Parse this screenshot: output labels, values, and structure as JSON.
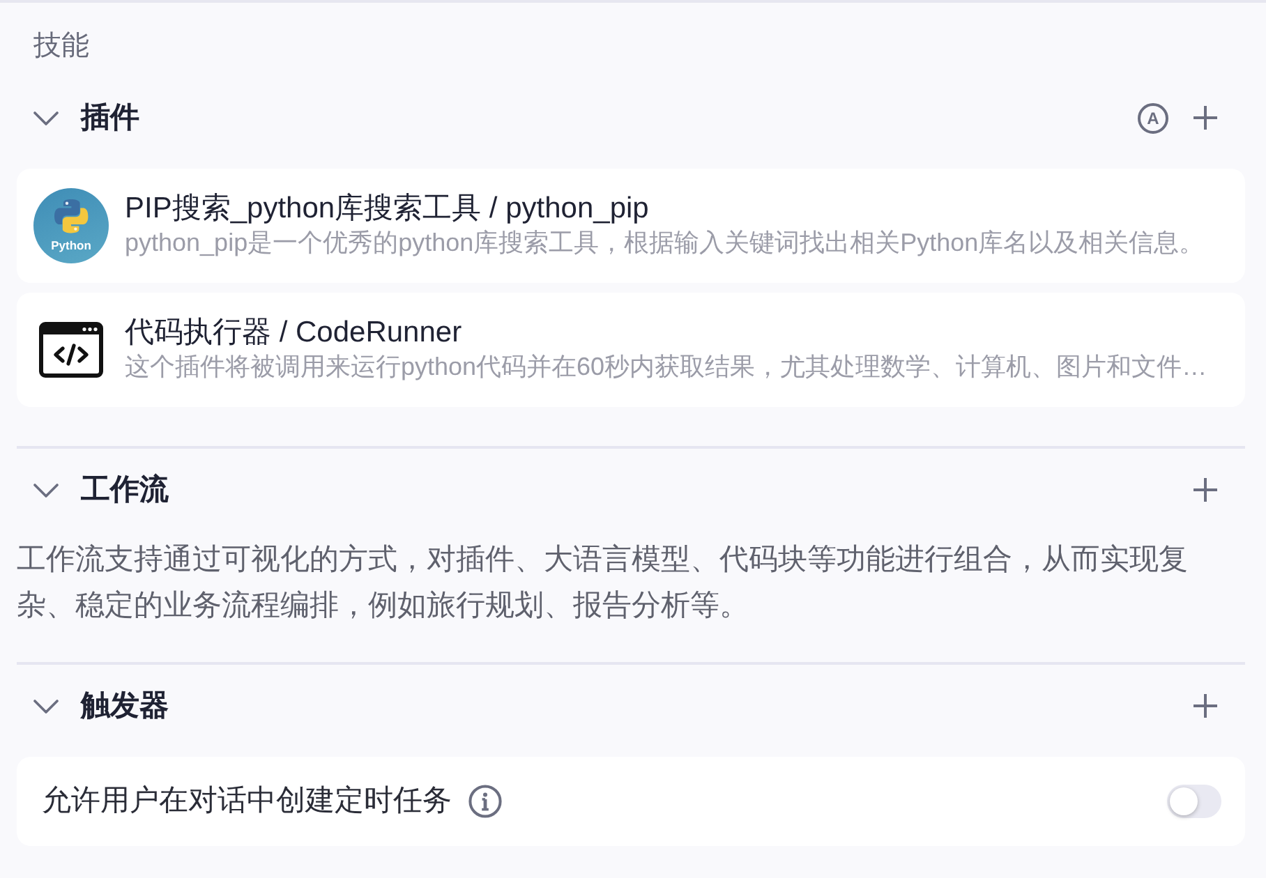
{
  "heading": "技能",
  "sections": [
    {
      "kind": "plugins",
      "title": "插件",
      "expanded": true,
      "badge": "A",
      "items": [
        {
          "kind": "python-logo",
          "logo_text": "Python",
          "name": "PIP搜索_python库搜索工具 / python_pip",
          "description": "python_pip是一个优秀的python库搜索工具，根据输入关键词找出相关Python库名以及相关信息。"
        },
        {
          "kind": "code-window",
          "name": "代码执行器 / CodeRunner",
          "description": "这个插件将被调用来运行python代码并在60秒内获取结果，尤其处理数学、计算机、图片和文件…"
        }
      ]
    },
    {
      "kind": "workflow",
      "title": "工作流",
      "expanded": true,
      "description": "工作流支持通过可视化的方式，对插件、大语言模型、代码块等功能进行组合，从而实现复杂、稳定的业务流程编排，例如旅行规划、报告分析等。"
    },
    {
      "kind": "trigger",
      "title": "触发器",
      "expanded": true,
      "settings": [
        {
          "label": "允许用户在对话中创建定时任务",
          "on": false
        }
      ]
    }
  ]
}
